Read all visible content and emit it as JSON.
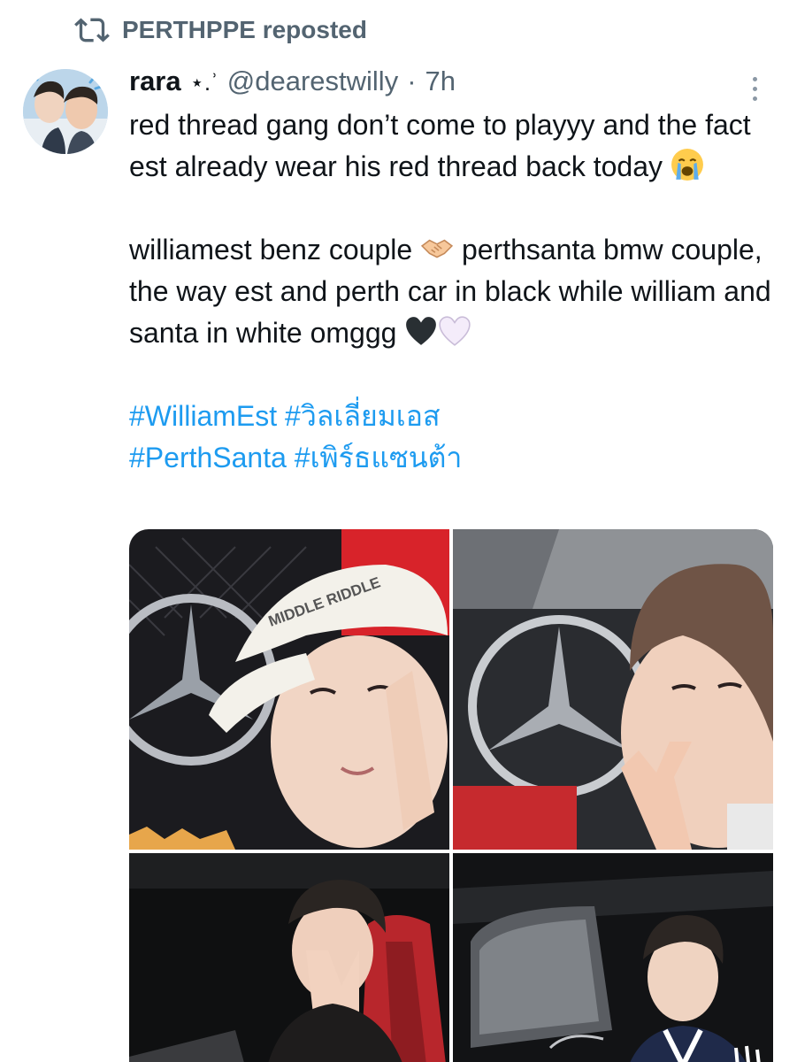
{
  "repost": {
    "label": "PERTHPPE reposted",
    "icon": "repost-icon"
  },
  "author": {
    "display_name": "rara",
    "name_decoration": "⋆.ʾ",
    "handle": "@dearestwilly",
    "separator": "·",
    "time": "7h"
  },
  "tweet": {
    "paragraph1": "red thread gang don’t come to playyy and the fact est already wear his red thread back today",
    "paragraph1_emoji": "loudly-crying-face",
    "paragraph2_part1": "williamest benz couple",
    "paragraph2_emoji": "handshake",
    "paragraph2_part2": "perthsanta bmw couple, the way est and perth car in black while william and santa in white omggg",
    "paragraph2_end_emojis": [
      "black-heart",
      "white-heart"
    ],
    "hashtags_line1": [
      "#WilliamEst",
      "#วิลเลี่ยมเอส"
    ],
    "hashtags_line2": [
      "#PerthSanta",
      "#เพิร์ธแซนต้า"
    ]
  },
  "media": {
    "count": 4,
    "photo1_cap_text": "MIDDLE RIDDLE"
  },
  "colors": {
    "accent": "#1d9bf0",
    "secondary_text": "#536471",
    "primary_text": "#0f1419"
  }
}
